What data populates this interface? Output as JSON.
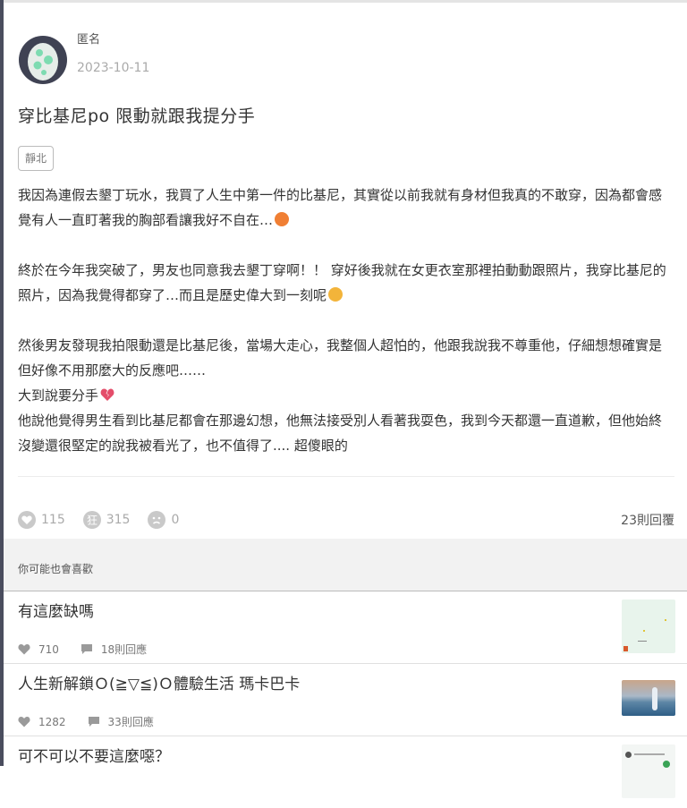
{
  "post": {
    "author": "匿名",
    "date": "2023-10-11",
    "title": "穿比基尼po 限動就跟我提分手",
    "tag": "靜北",
    "paragraphs": [
      "我因為連假去墾丁玩水，我買了人生中第一件的比基尼，其實從以前我就有身材但我真的不敢穿，因為都會感覺有人一直盯著我的胸部看讓我好不自在…",
      "終於在今年我突破了，男友也同意我去墾丁穿啊！！ 穿好後我就在女更衣室那裡拍動動跟照片，我穿比基尼的照片，因為我覺得都穿了…而且是歷史偉大到一刻呢",
      "然後男友發現我拍限動還是比基尼後，當場大走心，我整個人超怕的，他跟我說我不尊重他，仔細想想確實是但好像不用那麼大的反應吧……",
      "大到說要分手",
      "他說他覺得男生看到比基尼都會在那邊幻想，他無法接受別人看著我耍色，我到今天都還一直道歉，但他始終沒變還很堅定的說我被看光了，也不值得了.... 超傻眼的"
    ],
    "icons": [
      "angry-face-emoji",
      "smiling-face-emoji",
      "broken-heart-emoji"
    ],
    "stats": {
      "likes": "115",
      "crazy": "315",
      "other": "0",
      "replies": "23則回覆"
    }
  },
  "recommendations": {
    "header": "你可能也會喜歡",
    "items": [
      {
        "title": "有這麼缺嗎",
        "likes": "710",
        "replies": "18則回應"
      },
      {
        "title": "人生新解鎖Ｏ(≧▽≦)Ｏ體驗生活 瑪卡巴卡",
        "likes": "1282",
        "replies": "33則回應"
      },
      {
        "title": "可不可以不要這麼噁？",
        "likes": "",
        "replies": ""
      }
    ]
  }
}
